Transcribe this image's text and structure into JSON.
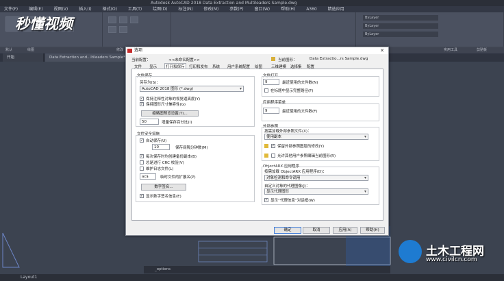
{
  "app": {
    "title": "Autodesk AutoCAD 2018   Data Extraction and Multileaders Sample.dwg",
    "menu": [
      "文件(F)",
      "编辑(E)",
      "视图(V)",
      "插入(I)",
      "格式(O)",
      "工具(T)",
      "绘图(D)",
      "标注(N)",
      "修改(M)",
      "参数(P)",
      "窗口(W)",
      "帮助(H)",
      "A360",
      "精选应用"
    ],
    "ribbon_labels": [
      "默认",
      "绘图",
      "修改",
      "实用工具",
      "剪贴板"
    ],
    "layer_names": [
      "ByLayer",
      "ByLayer",
      "ByLayer"
    ],
    "doc_tabs": [
      "开始",
      "Data Extraction and...ltileaders Sample*"
    ],
    "command_prompt": "_options",
    "layout_tab": "Layout1"
  },
  "dialog": {
    "title": "选项",
    "current_profile_label": "当前配置：",
    "current_profile_value": "<<未命名配置>>",
    "current_drawing_label": "当前图形：",
    "current_drawing_value": "Data Extractio...rs Sample.dwg",
    "tabs": [
      "文件",
      "显示",
      "打开和保存",
      "打印和发布",
      "系统",
      "用户系统配置",
      "绘图",
      "三维建模",
      "选择集",
      "配置"
    ],
    "active_tab_index": 2,
    "file_save": {
      "group": "文件保存",
      "save_as_label": "另存为(S)：",
      "save_as_value": "AutoCAD 2018 图形 (*.dwg)",
      "opt1": "保持注释性对象的视觉逼真度(Y)",
      "opt2": "保持图形尺寸兼容性(G)",
      "thumb_button": "缩略图预览设置(T)...",
      "incremental_value": "50",
      "incremental_label": "增量保存百分比(I)"
    },
    "file_safety": {
      "group": "文件安全措施",
      "autosave": "自动保存(U)",
      "minutes_value": "10",
      "minutes_label": "保存间隔分钟数(M)",
      "backup": "每次保存时均创建备份副本(B)",
      "crc": "总是进行 CRC 校验(V)",
      "log": "维护日志文件(L)",
      "ext_value": "ac$",
      "ext_label": "临时文件的扩展名(P)",
      "sign_button": "数字签名...",
      "show_sign": "显示数字签名信息(E)"
    },
    "file_open": {
      "group": "文件打开",
      "recent_value": "9",
      "recent_label": "最近使用的文件数(N)",
      "fullpath": "在标题中显示完整路径(F)"
    },
    "app_menu": {
      "group": "应用程序菜单",
      "recent_value": "9",
      "recent_label": "最近使用的文件数(F)"
    },
    "xref": {
      "group": "外部参照",
      "demand_label": "按需加载外部参照文件(X)：",
      "demand_value": "使用副本",
      "retain": "保留外部参照图层的修改(Y)",
      "allow_edit": "允许其他用户参照编辑当前图形(R)"
    },
    "objectarx": {
      "group": "ObjectARX 应用程序",
      "load_label": "按需加载 ObjectARX 应用程序(D)：",
      "load_value": "对象检测和命令调用",
      "proxy_label": "自定义对象的代理图像(J)：",
      "proxy_value": "显示代理图形",
      "proxy_dialog": "显示“代理信息”对话框(W)"
    },
    "buttons": {
      "ok": "确定",
      "cancel": "取消",
      "apply": "应用(A)",
      "help": "帮助(H)"
    }
  },
  "watermarks": {
    "left": "秒懂视频",
    "right_title": "土木工程网",
    "right_url": "www.civilcn.com"
  }
}
